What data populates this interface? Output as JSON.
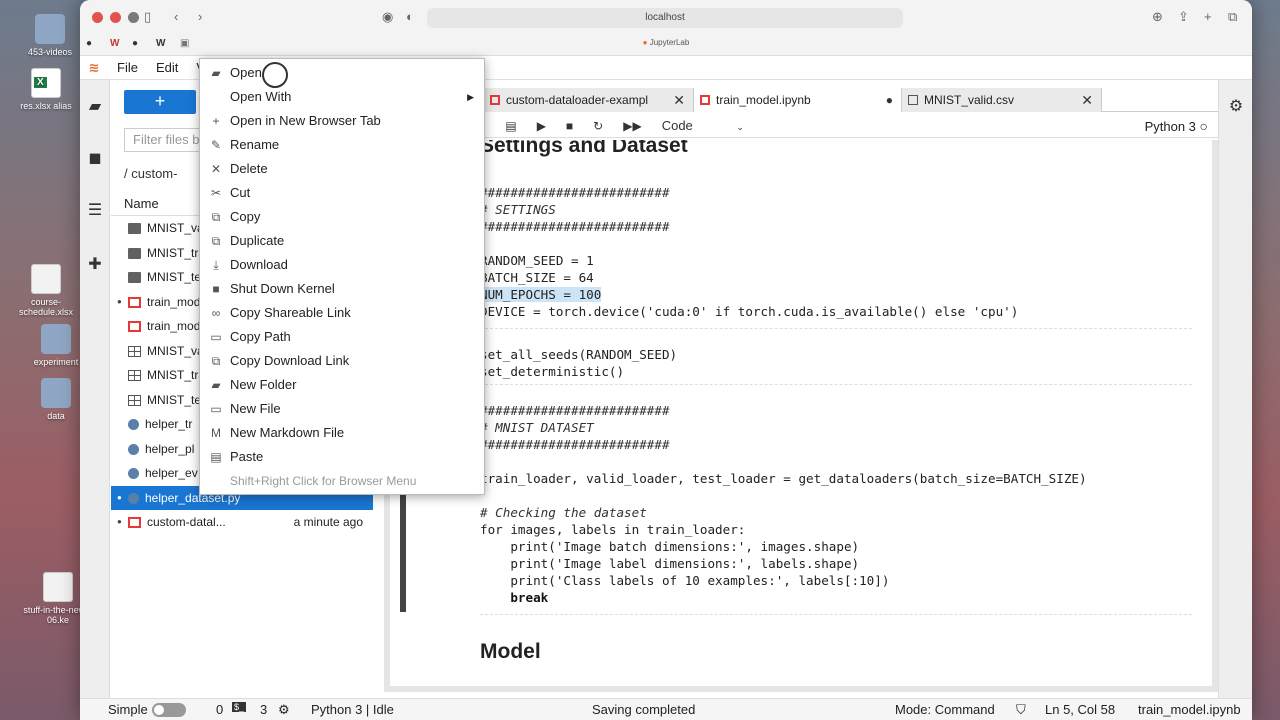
{
  "desktop": {
    "items": [
      {
        "label": "453-videos"
      },
      {
        "label": "res.xlsx alias"
      },
      {
        "label": "course-schedule.xlsx"
      },
      {
        "label": "experiment"
      },
      {
        "label": "data"
      },
      {
        "label": "stuff-in-the-news-06.ke"
      }
    ]
  },
  "browser": {
    "url": "localhost",
    "tab_title": "JupyterLab"
  },
  "menubar": {
    "items": [
      "File",
      "Edit",
      "V"
    ]
  },
  "filebrowser": {
    "new_label": "+",
    "filter_placeholder": "Filter files b",
    "breadcrumb": "/ custom-",
    "name_header": "Name",
    "rows": [
      {
        "name": "MNIST_va",
        "type": "folder",
        "modified": ""
      },
      {
        "name": "MNIST_tra",
        "type": "folder",
        "modified": ""
      },
      {
        "name": "MNIST_tes",
        "type": "folder",
        "modified": ""
      },
      {
        "name": "train_mod",
        "type": "notebook",
        "modified": ""
      },
      {
        "name": "train_mod",
        "type": "notebook",
        "modified": ""
      },
      {
        "name": "MNIST_va",
        "type": "csv",
        "modified": ""
      },
      {
        "name": "MNIST_tra",
        "type": "csv",
        "modified": ""
      },
      {
        "name": "MNIST_tes",
        "type": "csv",
        "modified": ""
      },
      {
        "name": "helper_tr",
        "type": "python",
        "modified": ""
      },
      {
        "name": "helper_pl",
        "type": "python",
        "modified": ""
      },
      {
        "name": "helper_ev",
        "type": "python",
        "modified": ""
      },
      {
        "name": "helper_dataset.py",
        "type": "python",
        "modified": ""
      },
      {
        "name": "custom-datal...",
        "type": "notebook",
        "modified": "a minute ago"
      }
    ]
  },
  "context_menu": {
    "items": [
      {
        "label": "Open",
        "icon": "folder-icon"
      },
      {
        "label": "Open With",
        "icon": ""
      },
      {
        "label": "Open in New Browser Tab",
        "icon": "plus-icon"
      },
      {
        "label": "Rename",
        "icon": "pencil-icon"
      },
      {
        "label": "Delete",
        "icon": "close-icon"
      },
      {
        "label": "Cut",
        "icon": "scissors-icon"
      },
      {
        "label": "Copy",
        "icon": "copy-icon"
      },
      {
        "label": "Duplicate",
        "icon": "duplicate-icon"
      },
      {
        "label": "Download",
        "icon": "download-icon"
      },
      {
        "label": "Shut Down Kernel",
        "icon": "stop-icon"
      },
      {
        "label": "Copy Shareable Link",
        "icon": "link-icon"
      },
      {
        "label": "Copy Path",
        "icon": "file-icon"
      },
      {
        "label": "Copy Download Link",
        "icon": "copy-icon"
      },
      {
        "label": "New Folder",
        "icon": "folder-icon"
      },
      {
        "label": "New File",
        "icon": "file-icon"
      },
      {
        "label": "New Markdown File",
        "icon": "markdown-icon"
      },
      {
        "label": "Paste",
        "icon": "clipboard-icon"
      },
      {
        "label": "Shift+Right Click for Browser Menu",
        "icon": ""
      }
    ]
  },
  "tabs": [
    {
      "label": "",
      "active": false
    },
    {
      "label": "custom-dataloader-exampl",
      "active": false
    },
    {
      "label": "train_model.ipynb",
      "active": true
    },
    {
      "label": "MNIST_valid.csv",
      "active": false
    }
  ],
  "toolbar": {
    "cell_type": "Code",
    "kernel": "Python 3"
  },
  "notebook": {
    "heading1": "Settings and Dataset",
    "heading2": "Model",
    "code1": [
      "#########################",
      "# SETTINGS",
      "#########################",
      "",
      "RANDOM_SEED = 1",
      "BATCH_SIZE = 64",
      "NUM_EPOCHS = 100",
      "DEVICE = torch.device('cuda:0' if torch.cuda.is_available() else 'cpu')"
    ],
    "code2": [
      "set_all_seeds(RANDOM_SEED)",
      "set_deterministic()"
    ],
    "code3": [
      "#########################",
      "# MNIST DATASET",
      "#########################",
      "",
      "train_loader, valid_loader, test_loader = get_dataloaders(batch_size=BATCH_SIZE)",
      "",
      "# Checking the dataset",
      "for images, labels in train_loader:",
      "    print('Image batch dimensions:', images.shape)",
      "    print('Image label dimensions:', labels.shape)",
      "    print('Class labels of 10 examples:', labels[:10])",
      "    break"
    ]
  },
  "statusbar": {
    "mode_label": "Simple",
    "count1": "0",
    "count2": "3",
    "kernel_status": "Python 3 | Idle",
    "save_status": "Saving completed",
    "mode": "Mode: Command",
    "position": "Ln 5, Col 58",
    "filename": "train_model.ipynb"
  }
}
